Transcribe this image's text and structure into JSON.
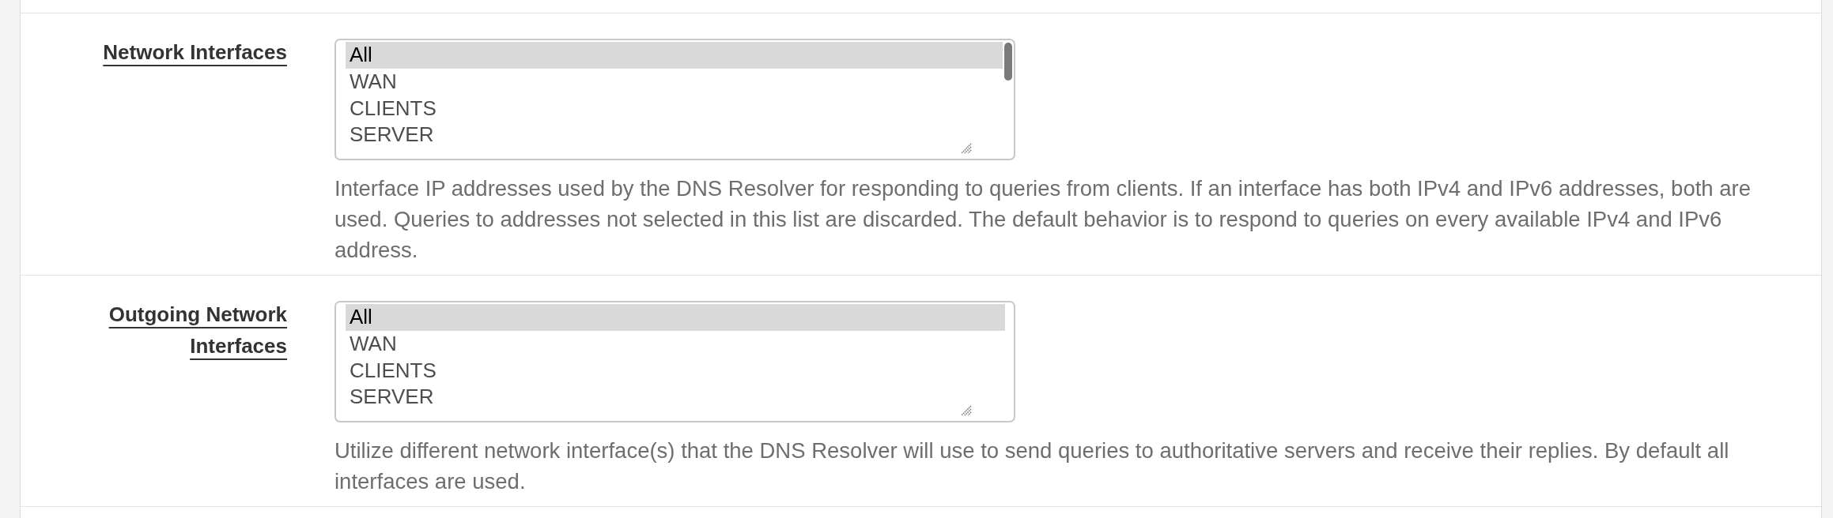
{
  "rows": [
    {
      "label": "Network Interfaces",
      "listbox": {
        "options": [
          {
            "text": "All",
            "selected": true
          },
          {
            "text": "WAN",
            "selected": false
          },
          {
            "text": "CLIENTS",
            "selected": false
          },
          {
            "text": "SERVER",
            "selected": false
          }
        ],
        "scrollbar": true
      },
      "help": "Interface IP addresses used by the DNS Resolver for responding to queries from clients. If an interface has both IPv4 and IPv6 addresses, both are used. Queries to addresses not selected in this list are discarded. The default behavior is to respond to queries on every available IPv4 and IPv6 address."
    },
    {
      "label": "Outgoing Network Interfaces",
      "listbox": {
        "options": [
          {
            "text": "All",
            "selected": true
          },
          {
            "text": "WAN",
            "selected": false
          },
          {
            "text": "CLIENTS",
            "selected": false
          },
          {
            "text": "SERVER",
            "selected": false
          }
        ],
        "scrollbar": false
      },
      "help": "Utilize different network interface(s) that the DNS Resolver will use to send queries to authoritative servers and receive their replies. By default all interfaces are used."
    }
  ]
}
